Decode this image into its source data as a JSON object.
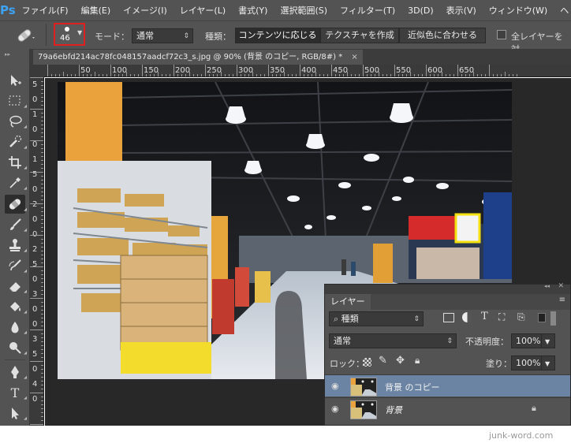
{
  "app": {
    "logo": "Ps"
  },
  "menu": [
    "ファイル(F)",
    "編集(E)",
    "イメージ(I)",
    "レイヤー(L)",
    "書式(Y)",
    "選択範囲(S)",
    "フィルター(T)",
    "3D(D)",
    "表示(V)",
    "ウィンドウ(W)",
    "ヘ"
  ],
  "options": {
    "brush_size": "46",
    "mode_label": "モード：",
    "mode_value": "通常",
    "type_label": "種類：",
    "type_buttons": [
      "コンテンツに応じる",
      "テクスチャを作成",
      "近似色に合わせる"
    ],
    "active_type": 0,
    "all_layers_label": "全レイヤーを対"
  },
  "document": {
    "tab_title": "79a6ebfd214ac78fc048157aadcf72c3_s.jpg @ 90% (背景 のコピー, RGB/8#) *",
    "close": "×"
  },
  "ruler": {
    "h_labels": [
      "50",
      "100",
      "150",
      "200",
      "250",
      "300",
      "350",
      "400",
      "450",
      "500",
      "550",
      "600",
      "650"
    ],
    "v_labels": [
      "5",
      "0",
      "1",
      "0",
      "0",
      "1",
      "5",
      "0",
      "2",
      "0",
      "0",
      "2",
      "5",
      "0",
      "3",
      "0",
      "0",
      "3",
      "5",
      "0",
      "4",
      "0"
    ]
  },
  "layers_panel": {
    "tab_label": "レイヤー",
    "filter_value": "種類",
    "blend_mode": "通常",
    "opacity_label": "不透明度：",
    "opacity_value": "100%",
    "lock_label": "ロック：",
    "fill_label": "塗り：",
    "fill_value": "100%",
    "layers": [
      {
        "name": "背景 のコピー",
        "selected": true,
        "locked": false
      },
      {
        "name": "背景",
        "selected": false,
        "locked": true
      }
    ]
  },
  "watermark": "junk-word.com",
  "colors": {
    "accent": "#3ea3f5",
    "highlight": "#e02020",
    "selected_layer": "#6b84a3"
  }
}
